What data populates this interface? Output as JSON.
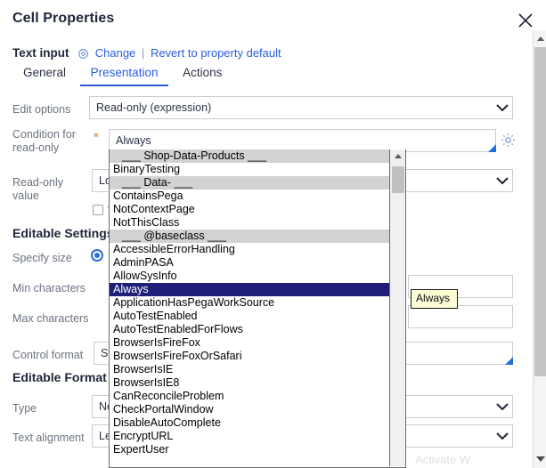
{
  "dialog": {
    "title": "Cell Properties",
    "close_icon": "close-icon"
  },
  "control": {
    "name": "Text input",
    "target_icon": "target-icon",
    "change_label": "Change",
    "separator": "|",
    "revert_label": "Revert to property default"
  },
  "tabs": [
    {
      "label": "General",
      "active": false
    },
    {
      "label": "Presentation",
      "active": true
    },
    {
      "label": "Actions",
      "active": false
    }
  ],
  "form": {
    "edit_options": {
      "label": "Edit options",
      "value": "Read-only (expression)"
    },
    "condition_read_only": {
      "label": "Condition for read-only",
      "value": "Always",
      "required_marker": "*"
    },
    "read_only_value": {
      "label": "Read-only value",
      "value": "Lo"
    },
    "watermark_checkbox": {
      "label": "V",
      "checked": false
    },
    "editable_settings_heading": "Editable Settings",
    "specify_size": {
      "label": "Specify size",
      "selected": true
    },
    "min_characters": {
      "label": "Min characters",
      "value": ""
    },
    "max_characters": {
      "label": "Max characters",
      "value": ""
    },
    "control_format": {
      "label": "Control format",
      "value": "Sta"
    },
    "editable_format_heading": "Editable Format",
    "type": {
      "label": "Type",
      "value": "No"
    },
    "text_alignment": {
      "label": "Text alignment",
      "value": "Le"
    },
    "gear_icon": "gear-icon"
  },
  "autocomplete": {
    "selected_value": "Always",
    "tooltip": "Always",
    "scroll_up_icon": "scroll-up-arrow-icon",
    "options": [
      {
        "label": "___  Shop-Data-Products  ___",
        "group": true
      },
      {
        "label": "BinaryTesting",
        "group": false
      },
      {
        "label": "___  Data-  ___",
        "group": true
      },
      {
        "label": "ContainsPega",
        "group": false
      },
      {
        "label": "NotContextPage",
        "group": false
      },
      {
        "label": "NotThisClass",
        "group": false
      },
      {
        "label": "___  @baseclass  ___",
        "group": true
      },
      {
        "label": "AccessibleErrorHandling",
        "group": false
      },
      {
        "label": "AdminPASA",
        "group": false
      },
      {
        "label": "AllowSysInfo",
        "group": false
      },
      {
        "label": "Always",
        "group": false,
        "selected": true
      },
      {
        "label": "ApplicationHasPegaWorkSource",
        "group": false
      },
      {
        "label": "AutoTestEnabled",
        "group": false
      },
      {
        "label": "AutoTestEnabledForFlows",
        "group": false
      },
      {
        "label": "BrowserIsFireFox",
        "group": false
      },
      {
        "label": "BrowserIsFireFoxOrSafari",
        "group": false
      },
      {
        "label": "BrowserIsIE",
        "group": false
      },
      {
        "label": "BrowserIsIE8",
        "group": false
      },
      {
        "label": "CanReconcileProblem",
        "group": false
      },
      {
        "label": "CheckPortalWindow",
        "group": false
      },
      {
        "label": "DisableAutoComplete",
        "group": false
      },
      {
        "label": "EncryptURL",
        "group": false
      },
      {
        "label": "ExpertUser",
        "group": false
      }
    ]
  },
  "watermark": {
    "text": "Activate W"
  },
  "colors": {
    "accent": "#2a5de0",
    "selection": "#1f1f7a",
    "group_header": "#d2d2d2",
    "required": "#e07b1f",
    "tooltip_bg": "#fbfbd4"
  }
}
